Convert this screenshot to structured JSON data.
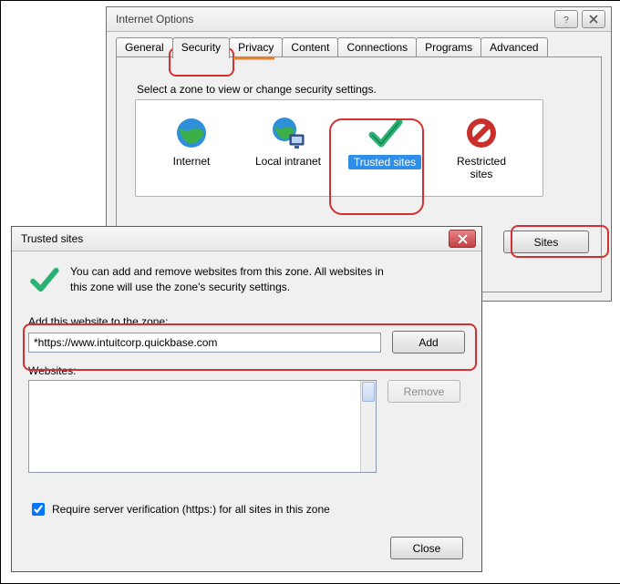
{
  "io": {
    "title": "Internet Options",
    "tabs": [
      "General",
      "Security",
      "Privacy",
      "Content",
      "Connections",
      "Programs",
      "Advanced"
    ],
    "zone_heading": "Select a zone to view or change security settings.",
    "zones": {
      "internet": "Internet",
      "intranet": "Local intranet",
      "trusted": "Trusted sites",
      "restricted_l1": "Restricted",
      "restricted_l2": "sites"
    },
    "sites_btn": "Sites"
  },
  "ts": {
    "title": "Trusted sites",
    "intro1": "You can add and remove websites from this zone. All websites in",
    "intro2": "this zone will use the zone's security settings.",
    "add_label": "Add this website to the zone:",
    "url_value": "*https://www.intuitcorp.quickbase.com",
    "add_btn": "Add",
    "websites_label": "Websites:",
    "remove_btn": "Remove",
    "require_label": "Require server verification (https:) for all sites in this zone",
    "close_btn": "Close"
  }
}
